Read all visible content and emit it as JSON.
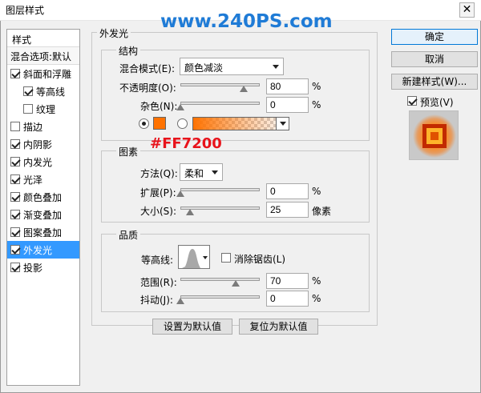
{
  "window": {
    "title": "图层样式",
    "close_glyph": "✕"
  },
  "watermark": "www.240PS.com",
  "sidebar": {
    "header": "样式",
    "subheader": "混合选项:默认",
    "items": [
      {
        "label": "斜面和浮雕",
        "checked": true
      },
      {
        "label": "等高线",
        "checked": true
      },
      {
        "label": "纹理",
        "checked": false
      },
      {
        "label": "描边",
        "checked": false
      },
      {
        "label": "内阴影",
        "checked": true
      },
      {
        "label": "内发光",
        "checked": true
      },
      {
        "label": "光泽",
        "checked": true
      },
      {
        "label": "颜色叠加",
        "checked": true
      },
      {
        "label": "渐变叠加",
        "checked": true
      },
      {
        "label": "图案叠加",
        "checked": true
      },
      {
        "label": "外发光",
        "checked": true,
        "selected": true
      },
      {
        "label": "投影",
        "checked": true
      }
    ]
  },
  "panel": {
    "title": "外发光",
    "structure": {
      "legend": "结构",
      "blend_mode_label": "混合模式(E):",
      "blend_mode_value": "颜色减淡",
      "opacity_label": "不透明度(O):",
      "opacity_value": "80",
      "opacity_unit": "%",
      "noise_label": "杂色(N):",
      "noise_value": "0",
      "noise_unit": "%",
      "color": "#ff7200",
      "hex_note": "#FF7200"
    },
    "elements": {
      "legend": "图素",
      "technique_label": "方法(Q):",
      "technique_value": "柔和",
      "spread_label": "扩展(P):",
      "spread_value": "0",
      "spread_unit": "%",
      "size_label": "大小(S):",
      "size_value": "25",
      "size_unit": "像素"
    },
    "quality": {
      "legend": "品质",
      "contour_label": "等高线:",
      "antialias_label": "消除锯齿(L)",
      "range_label": "范围(R):",
      "range_value": "70",
      "range_unit": "%",
      "jitter_label": "抖动(J):",
      "jitter_value": "0",
      "jitter_unit": "%"
    },
    "make_default_button": "设置为默认值",
    "reset_default_button": "复位为默认值"
  },
  "actions": {
    "ok_button": "确定",
    "cancel_button": "取消",
    "new_style_button": "新建样式(W)...",
    "preview_label": "预览(V)",
    "preview_checked": true
  },
  "sliders": {
    "opacity_fraction": 0.8,
    "noise_fraction": 0.0,
    "spread_fraction": 0.0,
    "size_fraction": 0.125,
    "range_fraction": 0.7,
    "jitter_fraction": 0.0
  }
}
